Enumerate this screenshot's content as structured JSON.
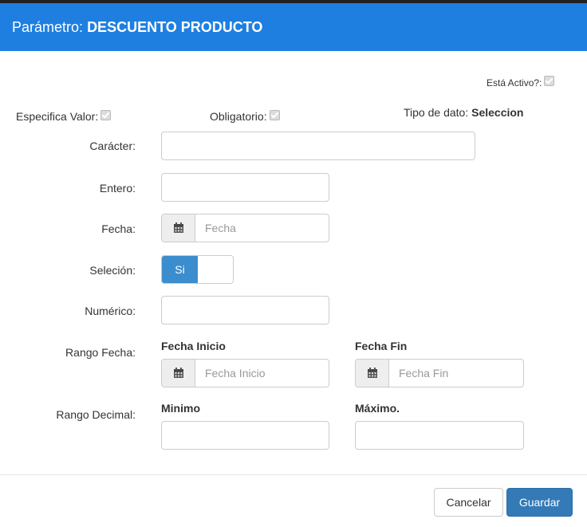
{
  "header": {
    "prefix": "Parámetro:",
    "name": "DESCUENTO PRODUCTO"
  },
  "flags": {
    "active_label": "Está Activo?:",
    "specifies_value_label": "Especifica Valor:",
    "required_label": "Obligatorio:",
    "data_type_label": "Tipo de dato:",
    "data_type_value": "Seleccion"
  },
  "fields": {
    "caracter_label": "Carácter:",
    "entero_label": "Entero:",
    "fecha_label": "Fecha:",
    "fecha_placeholder": "Fecha",
    "seleccion_label": "Seleción:",
    "seleccion_value": "Si",
    "numerico_label": "Numérico:",
    "rango_fecha_label": "Rango Fecha:",
    "fecha_inicio_label": "Fecha Inicio",
    "fecha_inicio_placeholder": "Fecha Inicio",
    "fecha_fin_label": "Fecha Fin",
    "fecha_fin_placeholder": "Fecha Fin",
    "rango_decimal_label": "Rango Decimal:",
    "minimo_label": "Minimo",
    "maximo_label": "Máximo."
  },
  "footer": {
    "cancel": "Cancelar",
    "save": "Guardar"
  },
  "colors": {
    "header_bg": "#1e7fe0",
    "primary": "#337ab7",
    "toggle_on": "#3c8dcd"
  },
  "icons": {
    "date_addon": "calendar-icon",
    "checkbox": "checkmark"
  }
}
